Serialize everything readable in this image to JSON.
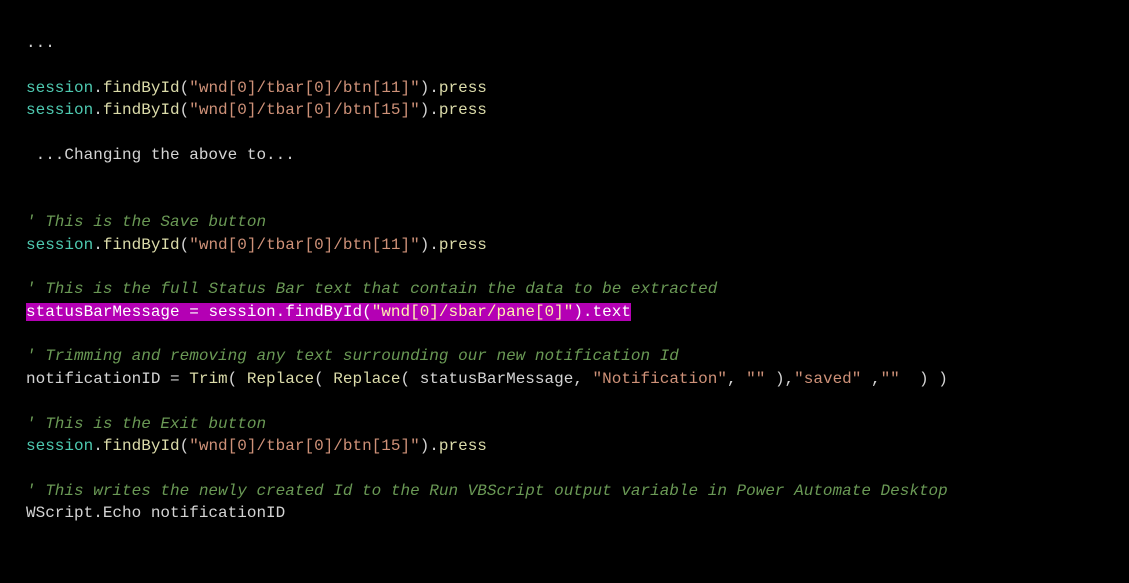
{
  "colors": {
    "background": "#000000",
    "object": "#4EC9B0",
    "method": "#DCDCAA",
    "string": "#CE9178",
    "comment": "#6A9955",
    "keyword": "#569CD6",
    "plain": "#d4d4d4",
    "highlight_bg": "#b400b4"
  },
  "code": {
    "l1": "...",
    "l3a": "session",
    "l3b": ".",
    "l3c": "findById",
    "l3d": "(",
    "l3e": "\"wnd[0]/tbar[0]/btn[11]\"",
    "l3f": ").",
    "l3g": "press",
    "l4a": "session",
    "l4b": ".",
    "l4c": "findById",
    "l4d": "(",
    "l4e": "\"wnd[0]/tbar[0]/btn[15]\"",
    "l4f": ").",
    "l4g": "press",
    "l6": " ...Changing the above to...",
    "l9": "' This is the Save button",
    "l10a": "session",
    "l10b": ".",
    "l10c": "findById",
    "l10d": "(",
    "l10e": "\"wnd[0]/tbar[0]/btn[11]\"",
    "l10f": ").",
    "l10g": "press",
    "l12": "' This is the full Status Bar text that contain the data to be extracted",
    "l13a": "statusBarMessage = ",
    "l13b": "session",
    "l13c": ".",
    "l13d": "findById",
    "l13e": "(",
    "l13f": "\"wnd[0]/sbar/pane[0]\"",
    "l13g": ").",
    "l13h": "text",
    "l15": "' Trimming and removing any text surrounding our new notification Id",
    "l16a": "notificationID = ",
    "l16b": "Trim",
    "l16c": "( ",
    "l16d": "Replace",
    "l16e": "( ",
    "l16f": "Replace",
    "l16g": "( statusBarMessage, ",
    "l16h": "\"Notification\"",
    "l16i": ", ",
    "l16j": "\"\"",
    "l16k": " ),",
    "l16l": "\"saved\"",
    "l16m": " ,",
    "l16n": "\"\"",
    "l16o": "  ) )",
    "l18": "' This is the Exit button",
    "l19a": "session",
    "l19b": ".",
    "l19c": "findById",
    "l19d": "(",
    "l19e": "\"wnd[0]/tbar[0]/btn[15]\"",
    "l19f": ").",
    "l19g": "press",
    "l21": "' This writes the newly created Id to the Run VBScript output variable in Power Automate Desktop",
    "l22": "WScript.Echo notificationID"
  }
}
